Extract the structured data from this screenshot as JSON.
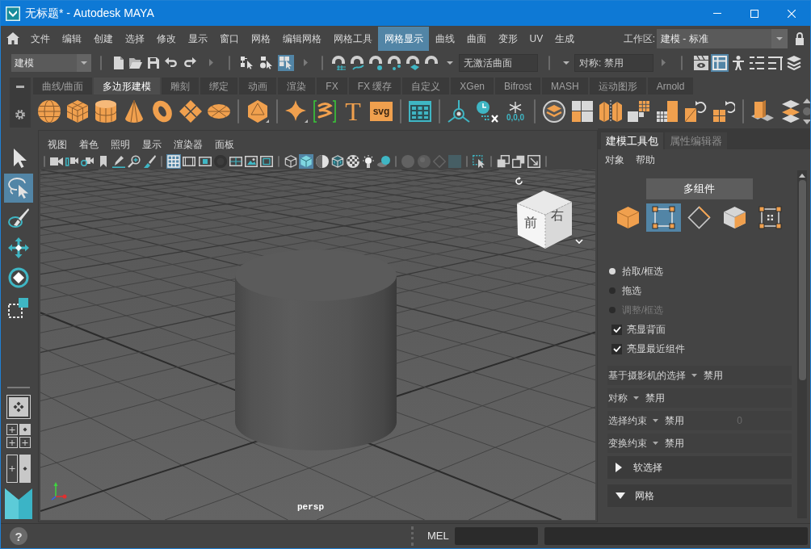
{
  "window": {
    "title": "无标题* - Autodesk MAYA"
  },
  "menu_bar": {
    "items": [
      {
        "label": "文件",
        "selected": false
      },
      {
        "label": "编辑",
        "selected": false
      },
      {
        "label": "创建",
        "selected": false
      },
      {
        "label": "选择",
        "selected": false
      },
      {
        "label": "修改",
        "selected": false
      },
      {
        "label": "显示",
        "selected": false
      },
      {
        "label": "窗口",
        "selected": false
      },
      {
        "label": "网格",
        "selected": false
      },
      {
        "label": "编辑网格",
        "selected": false
      },
      {
        "label": "网格工具",
        "selected": false
      },
      {
        "label": "网格显示",
        "selected": true
      },
      {
        "label": "曲线",
        "selected": false
      },
      {
        "label": "曲面",
        "selected": false
      },
      {
        "label": "变形",
        "selected": false
      },
      {
        "label": "UV",
        "selected": false
      },
      {
        "label": "生成",
        "selected": false
      }
    ],
    "workspace_label": "工作区:",
    "workspace": "建模 - 标准"
  },
  "status_line": {
    "menu_set": "建模",
    "selection_modes": [
      {
        "selected": false
      },
      {
        "selected": false
      },
      {
        "selected": true
      }
    ],
    "live_surface": "无激活曲面",
    "symmetry": "对称: 禁用",
    "panel_toggles": [
      {
        "selected": false
      },
      {
        "selected": true
      },
      {
        "selected": false
      },
      {
        "selected": false
      },
      {
        "selected": false
      },
      {
        "selected": false
      }
    ]
  },
  "shelf": {
    "tabs": [
      {
        "label": "曲线/曲面",
        "selected": false
      },
      {
        "label": "多边形建模",
        "selected": true
      },
      {
        "label": "雕刻",
        "selected": false
      },
      {
        "label": "绑定",
        "selected": false
      },
      {
        "label": "动画",
        "selected": false
      },
      {
        "label": "渲染",
        "selected": false
      },
      {
        "label": "FX",
        "selected": false
      },
      {
        "label": "FX 缓存",
        "selected": false
      },
      {
        "label": "自定义",
        "selected": false
      },
      {
        "label": "XGen",
        "selected": false
      },
      {
        "label": "Bifrost",
        "selected": false
      },
      {
        "label": "MASH",
        "selected": false
      },
      {
        "label": "运动图形",
        "selected": false
      },
      {
        "label": "Arnold",
        "selected": false
      }
    ],
    "type_tool_label": "T",
    "svg_tool_label": "svg",
    "snowflake_tool_readout": "0,0,0"
  },
  "toolbox": {
    "tools": [
      {
        "selected": false
      },
      {
        "selected": true
      },
      {
        "selected": false
      },
      {
        "selected": false
      },
      {
        "selected": false
      },
      {
        "selected": false
      }
    ]
  },
  "viewport": {
    "menus": [
      "视图",
      "着色",
      "照明",
      "显示",
      "渲染器",
      "面板"
    ],
    "toolbar_groups": [
      {
        "buttons": [
          {
            "selected": false
          },
          {
            "selected": false
          },
          {
            "selected": false
          },
          {
            "selected": false
          },
          {
            "selected": false
          },
          {
            "selected": false
          },
          {
            "selected": false
          }
        ]
      },
      {
        "buttons": [
          {
            "selected": true
          },
          {
            "selected": false
          },
          {
            "selected": false
          },
          {
            "selected": false
          },
          {
            "selected": false
          },
          {
            "selected": false
          },
          {
            "selected": false
          }
        ]
      },
      {
        "buttons": [
          {
            "selected": false
          },
          {
            "selected": true
          },
          {
            "selected": false
          },
          {
            "selected": false
          },
          {
            "selected": false
          },
          {
            "selected": false
          },
          {
            "selected": false
          }
        ]
      },
      {
        "buttons": [
          {
            "selected": false,
            "disabled": true
          },
          {
            "selected": false,
            "disabled": true
          },
          {
            "selected": false,
            "disabled": true
          },
          {
            "selected": false,
            "disabled": true
          }
        ]
      },
      {
        "buttons": [
          {
            "selected": false
          }
        ]
      },
      {
        "buttons": [
          {
            "selected": false
          },
          {
            "selected": false
          },
          {
            "selected": false
          }
        ]
      }
    ],
    "view_cube": {
      "front": "前",
      "right": "右"
    },
    "camera": "persp"
  },
  "modeling_toolkit": {
    "tabs": [
      {
        "label": "建模工具包",
        "selected": true
      },
      {
        "label": "属性编辑器",
        "selected": false
      }
    ],
    "menus": [
      "对象",
      "帮助"
    ],
    "mode_button": "多组件",
    "component_modes": [
      {
        "selected": false
      },
      {
        "selected": true
      },
      {
        "selected": false
      },
      {
        "selected": false
      },
      {
        "selected": false
      }
    ],
    "selection_styles": [
      {
        "label": "拾取/框选",
        "selected": true,
        "disabled": false
      },
      {
        "label": "拖选",
        "selected": false,
        "disabled": false
      },
      {
        "label": "调整/框选",
        "selected": false,
        "disabled": true
      }
    ],
    "options": [
      {
        "label": "亮显背面",
        "checked": true
      },
      {
        "label": "亮显最近组件",
        "checked": true
      }
    ],
    "settings": [
      {
        "label": "基于摄影机的选择",
        "value": "禁用"
      },
      {
        "label": "对称",
        "value": "禁用"
      },
      {
        "label": "选择约束",
        "value": "禁用",
        "number": "0"
      },
      {
        "label": "变换约束",
        "value": "禁用"
      }
    ],
    "sections": [
      {
        "label": "软选择",
        "expanded": false
      },
      {
        "label": "网格",
        "expanded": true
      }
    ]
  },
  "command_line": {
    "language": "MEL"
  },
  "help_button": "?"
}
